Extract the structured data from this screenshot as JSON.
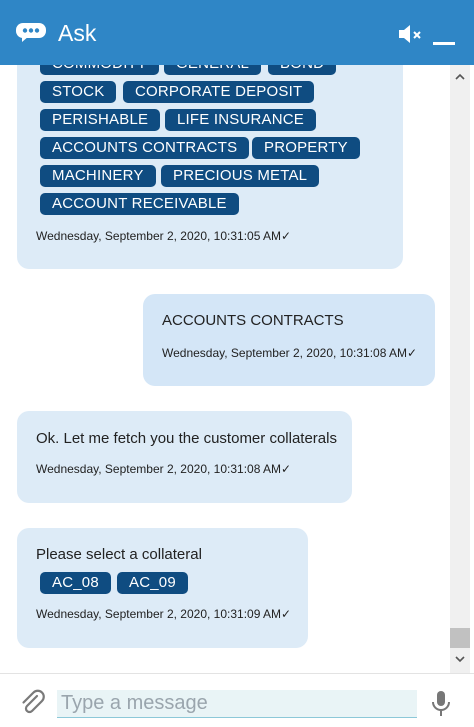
{
  "header": {
    "title": "Ask"
  },
  "messages": [
    {
      "chips": [
        "COMMODITY",
        "GENERAL",
        "BOND",
        "STOCK",
        "CORPORATE DEPOSIT",
        "PERISHABLE",
        "LIFE INSURANCE",
        "ACCOUNTS CONTRACTS",
        "PROPERTY",
        "MACHINERY",
        "PRECIOUS METAL",
        "ACCOUNT RECEIVABLE"
      ],
      "timestamp": "Wednesday, September 2, 2020, 10:31:05 AM✓"
    },
    {
      "text": "ACCOUNTS CONTRACTS",
      "timestamp": "Wednesday, September 2, 2020, 10:31:08 AM✓"
    },
    {
      "text": "Ok. Let me fetch you the customer collaterals",
      "timestamp": "Wednesday, September 2, 2020, 10:31:08 AM✓"
    },
    {
      "text": "Please select a collateral",
      "chips": [
        "AC_08",
        "AC_09"
      ],
      "timestamp": "Wednesday, September 2, 2020, 10:31:09 AM✓"
    }
  ],
  "input": {
    "placeholder": "Type a message",
    "value": ""
  },
  "icons": {
    "chat": "chat-bubble-icon",
    "mute": "speaker-mute-icon",
    "minimize": "minimize-icon",
    "attach": "paperclip-icon",
    "mic": "microphone-icon"
  },
  "colors": {
    "header": "#2f86c6",
    "chip": "#0f4c81",
    "bot_bubble": "#ddebf7",
    "user_bubble": "#d4e6f7"
  }
}
